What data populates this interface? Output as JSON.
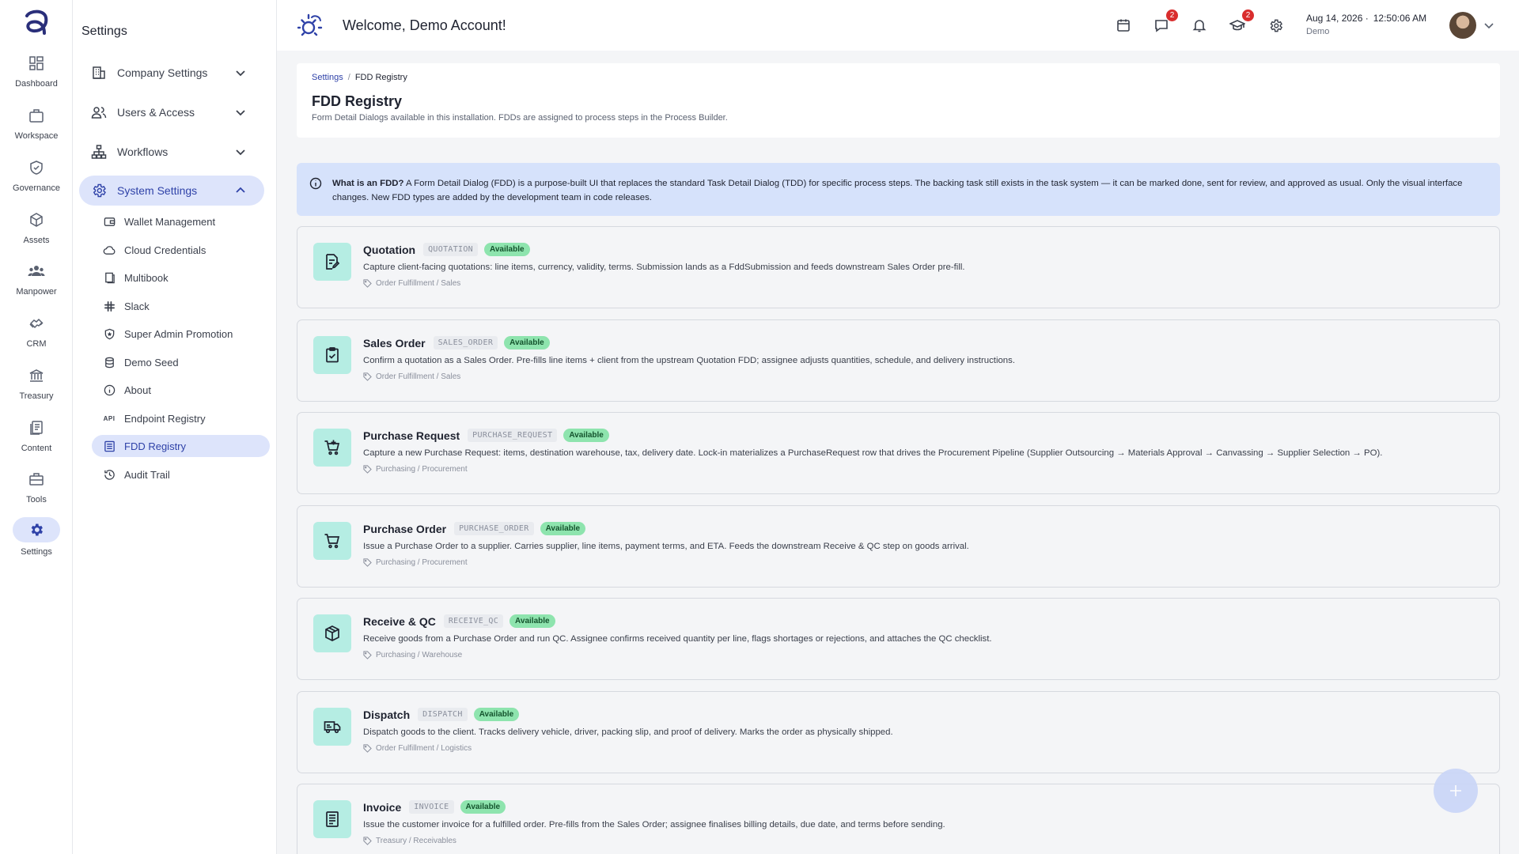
{
  "rail": {
    "items": [
      {
        "label": "Dashboard",
        "icon": "dashboard-icon"
      },
      {
        "label": "Workspace",
        "icon": "workspace-icon"
      },
      {
        "label": "Governance",
        "icon": "governance-icon"
      },
      {
        "label": "Assets",
        "icon": "assets-icon"
      },
      {
        "label": "Manpower",
        "icon": "manpower-icon"
      },
      {
        "label": "CRM",
        "icon": "crm-icon"
      },
      {
        "label": "Treasury",
        "icon": "treasury-icon"
      },
      {
        "label": "Content",
        "icon": "content-icon"
      },
      {
        "label": "Tools",
        "icon": "tools-icon"
      },
      {
        "label": "Settings",
        "icon": "settings-icon",
        "active": true
      }
    ]
  },
  "panel": {
    "title": "Settings",
    "groups": [
      {
        "label": "Company Settings",
        "icon": "building-icon",
        "expanded": false
      },
      {
        "label": "Users & Access",
        "icon": "users-icon",
        "expanded": false
      },
      {
        "label": "Workflows",
        "icon": "workflow-icon",
        "expanded": false
      },
      {
        "label": "System Settings",
        "icon": "gear-icon",
        "expanded": true,
        "active": true
      }
    ],
    "sub_items": [
      {
        "label": "Wallet Management",
        "icon": "wallet-icon"
      },
      {
        "label": "Cloud Credentials",
        "icon": "cloud-icon"
      },
      {
        "label": "Multibook",
        "icon": "book-icon"
      },
      {
        "label": "Slack",
        "icon": "slack-icon"
      },
      {
        "label": "Super Admin Promotion",
        "icon": "shield-star-icon"
      },
      {
        "label": "Demo Seed",
        "icon": "seed-icon"
      },
      {
        "label": "About",
        "icon": "info-icon"
      },
      {
        "label": "Endpoint Registry",
        "icon": "api-icon",
        "icon_text": "API"
      },
      {
        "label": "FDD Registry",
        "icon": "registry-icon",
        "active": true
      },
      {
        "label": "Audit Trail",
        "icon": "history-icon"
      }
    ]
  },
  "header": {
    "welcome": "Welcome, Demo Account!",
    "icons": [
      {
        "name": "calendar-icon"
      },
      {
        "name": "chat-icon",
        "badge": "2"
      },
      {
        "name": "bell-icon"
      },
      {
        "name": "graduation-cap-icon",
        "badge": "2"
      },
      {
        "name": "gear-icon"
      }
    ],
    "date": "Aug 14, 2026 ·",
    "time": "12:50:06 AM",
    "user": "Demo"
  },
  "breadcrumb": {
    "root": "Settings",
    "separator": "/",
    "current": "FDD Registry"
  },
  "page": {
    "title": "FDD Registry",
    "subtitle": "Form Detail Dialogs available in this installation. FDDs are assigned to process steps in the Process Builder."
  },
  "info": {
    "lead": "What is an FDD?",
    "text": " A Form Detail Dialog (FDD) is a purpose-built UI that replaces the standard Task Detail Dialog (TDD) for specific process steps. The backing task still exists in the task system — it can be marked done, sent for review, and approved as usual. Only the visual interface changes. New FDD types are added by the development team in code releases."
  },
  "cards": [
    {
      "title": "Quotation",
      "code": "QUOTATION",
      "status": "Available",
      "icon": "quotation-icon",
      "description": "Capture client-facing quotations: line items, currency, validity, terms. Submission lands as a FddSubmission and feeds downstream Sales Order pre-fill.",
      "category": "Order Fulfillment / Sales"
    },
    {
      "title": "Sales Order",
      "code": "SALES_ORDER",
      "status": "Available",
      "icon": "clipboard-check-icon",
      "description": "Confirm a quotation as a Sales Order. Pre-fills line items + client from the upstream Quotation FDD; assignee adjusts quantities, schedule, and delivery instructions.",
      "category": "Order Fulfillment / Sales"
    },
    {
      "title": "Purchase Request",
      "code": "PURCHASE_REQUEST",
      "status": "Available",
      "icon": "cart-plus-icon",
      "description": "Capture a new Purchase Request: items, destination warehouse, tax, delivery date. Lock-in materializes a PurchaseRequest row that drives the Procurement Pipeline (Supplier Outsourcing → Materials Approval → Canvassing → Supplier Selection → PO).",
      "category": "Purchasing / Procurement"
    },
    {
      "title": "Purchase Order",
      "code": "PURCHASE_ORDER",
      "status": "Available",
      "icon": "cart-icon",
      "description": "Issue a Purchase Order to a supplier. Carries supplier, line items, payment terms, and ETA. Feeds the downstream Receive & QC step on goods arrival.",
      "category": "Purchasing / Procurement"
    },
    {
      "title": "Receive & QC",
      "code": "RECEIVE_QC",
      "status": "Available",
      "icon": "package-check-icon",
      "description": "Receive goods from a Purchase Order and run QC. Assignee confirms received quantity per line, flags shortages or rejections, and attaches the QC checklist.",
      "category": "Purchasing / Warehouse"
    },
    {
      "title": "Dispatch",
      "code": "DISPATCH",
      "status": "Available",
      "icon": "truck-icon",
      "description": "Dispatch goods to the client. Tracks delivery vehicle, driver, packing slip, and proof of delivery. Marks the order as physically shipped.",
      "category": "Order Fulfillment / Logistics"
    },
    {
      "title": "Invoice",
      "code": "INVOICE",
      "status": "Available",
      "icon": "invoice-icon",
      "description": "Issue the customer invoice for a fulfilled order. Pre-fills from the Sales Order; assignee finalises billing details, due date, and terms before sending.",
      "category": "Treasury / Receivables"
    }
  ],
  "fab": {
    "icon": "plus-icon"
  },
  "colors": {
    "accent": "#2f42a8",
    "active_bg": "#dde4fb",
    "banner_bg": "#d6e2fb",
    "card_icon_bg": "#b5ede3",
    "status_bg": "#8ee4ae",
    "badge": "#d92d2d"
  }
}
